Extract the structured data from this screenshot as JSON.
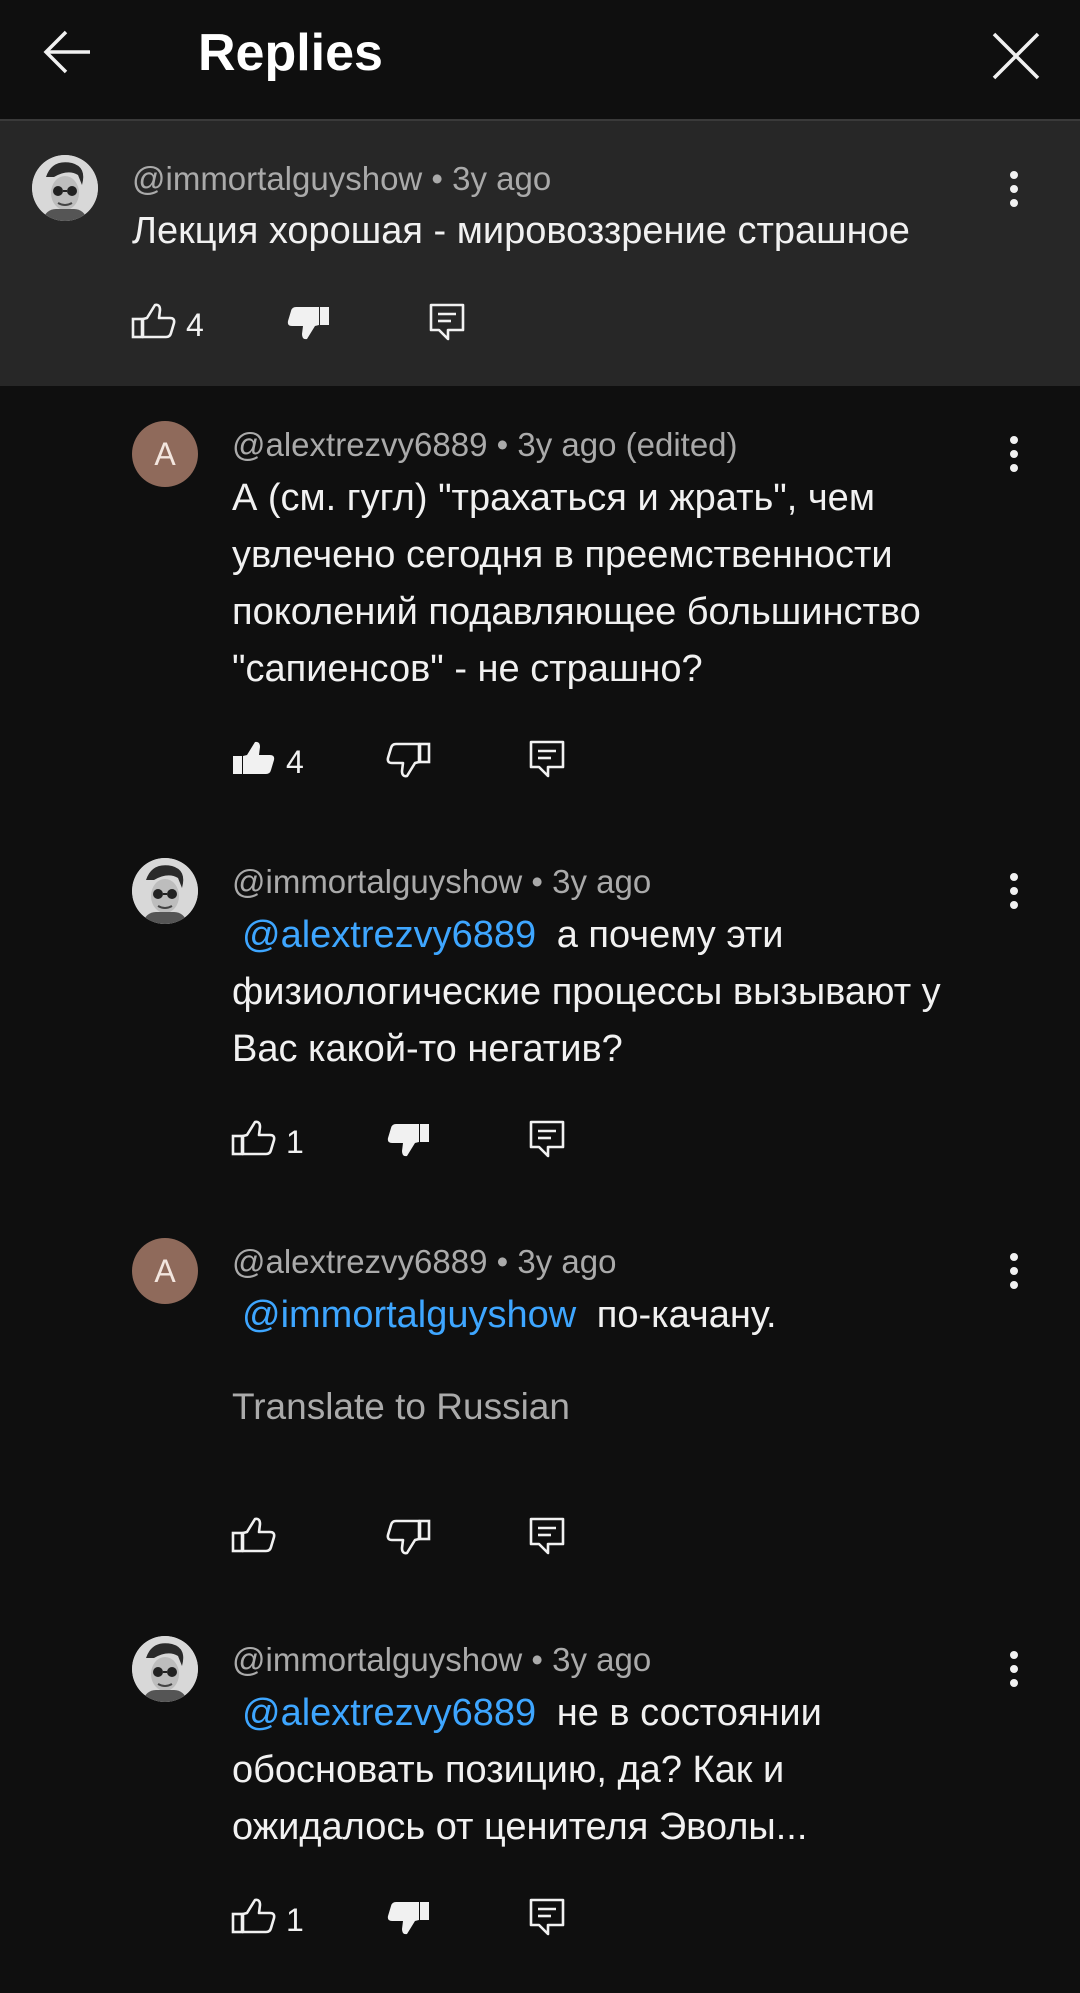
{
  "header": {
    "title": "Replies"
  },
  "top_comment": {
    "author": "@immortalguyshow",
    "time": "3y ago",
    "text": "Лекция хорошая - мировоззрение страшное",
    "likes": "4"
  },
  "replies": [
    {
      "author": "@alextrezvy6889",
      "time": "3y ago (edited)",
      "avatar_letter": "A",
      "lines": [
        "А (см. гугл) \"трахаться и жрать\", чем",
        "увлечено сегодня в преемственности",
        "поколений подавляющее большинство",
        "\"сапиенсов\" - не страшно?"
      ],
      "likes": "4"
    },
    {
      "author": "@immortalguyshow",
      "time": "3y ago",
      "mention": "@alextrezvy6889",
      "line1_rest": "а почему эти",
      "lines": [
        "физиологические процессы вызывают у",
        "Вас какой-то негатив?"
      ],
      "likes": "1"
    },
    {
      "author": "@alextrezvy6889",
      "time": "3y ago",
      "avatar_letter": "A",
      "mention": "@immortalguyshow",
      "line1_rest": "по-качану.",
      "translate": "Translate to Russian"
    },
    {
      "author": "@immortalguyshow",
      "time": "3y ago",
      "mention": "@alextrezvy6889",
      "line1_rest": "не в состоянии",
      "lines": [
        "обосновать позицию, да? Как и",
        "ожидалось от ценителя Эволы..."
      ],
      "likes": "1"
    }
  ],
  "separator": "•"
}
